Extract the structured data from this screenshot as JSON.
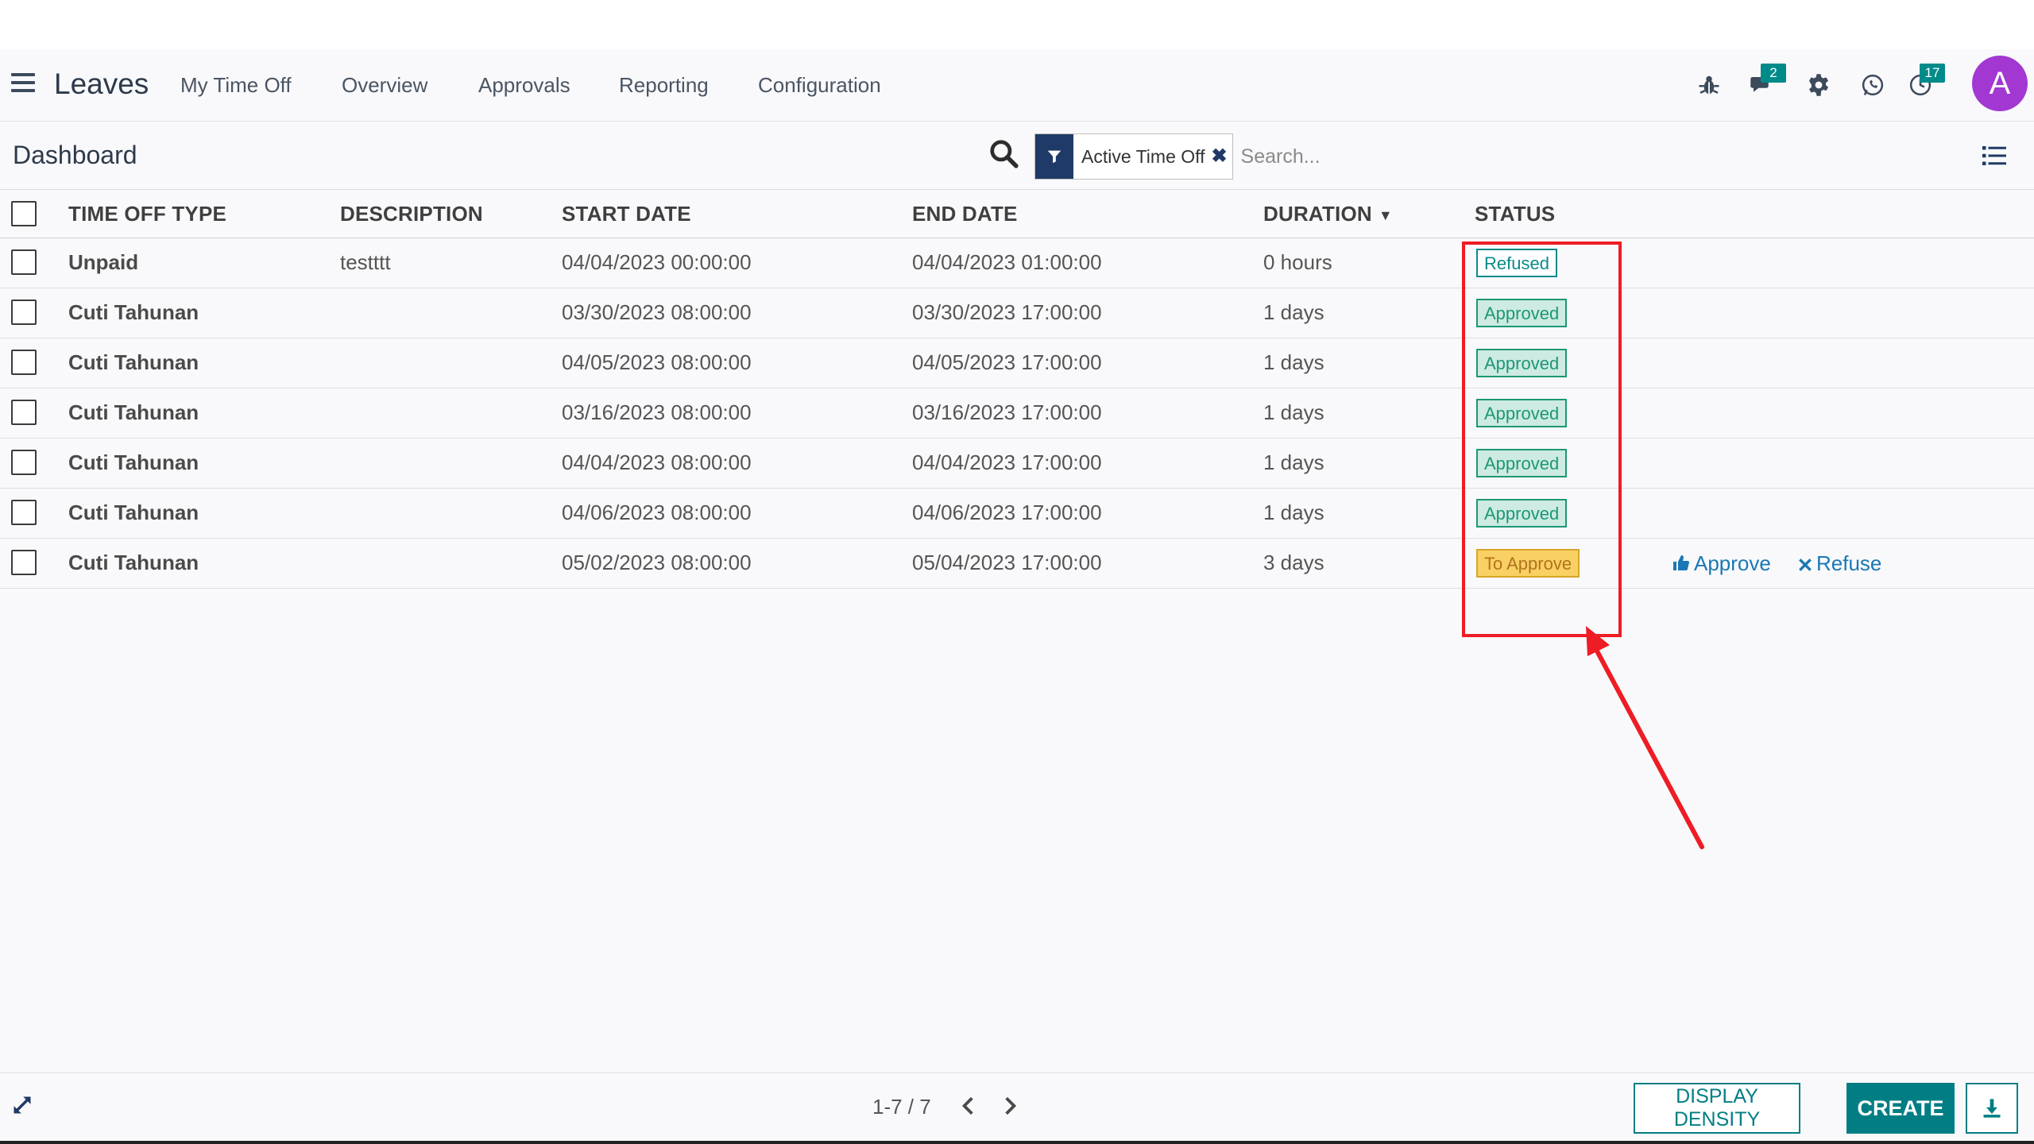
{
  "navbar": {
    "app_name": "Leaves",
    "menu": [
      "My Time Off",
      "Overview",
      "Approvals",
      "Reporting",
      "Configuration"
    ],
    "icons": [
      "bug-icon",
      "chat-icon",
      "gear-icon",
      "whatsapp-icon",
      "activity-icon"
    ],
    "messages_badge": "2",
    "activities_badge": "17",
    "avatar_letter": "A",
    "accent": "#a238d1"
  },
  "control": {
    "breadcrumb": "Dashboard",
    "facet_label": "Active Time Off",
    "search_placeholder": "Search..."
  },
  "table": {
    "columns": [
      "TIME OFF TYPE",
      "DESCRIPTION",
      "START DATE",
      "END DATE",
      "DURATION",
      "STATUS"
    ],
    "rows": [
      {
        "type": "Unpaid",
        "description": "testttt",
        "start": "04/04/2023 00:00:00",
        "end": "04/04/2023 01:00:00",
        "duration": "0 hours",
        "status": "Refused",
        "status_kind": "refused"
      },
      {
        "type": "Cuti Tahunan",
        "description": "",
        "start": "03/30/2023 08:00:00",
        "end": "03/30/2023 17:00:00",
        "duration": "1 days",
        "status": "Approved",
        "status_kind": "approved"
      },
      {
        "type": "Cuti Tahunan",
        "description": "",
        "start": "04/05/2023 08:00:00",
        "end": "04/05/2023 17:00:00",
        "duration": "1 days",
        "status": "Approved",
        "status_kind": "approved"
      },
      {
        "type": "Cuti Tahunan",
        "description": "",
        "start": "03/16/2023 08:00:00",
        "end": "03/16/2023 17:00:00",
        "duration": "1 days",
        "status": "Approved",
        "status_kind": "approved"
      },
      {
        "type": "Cuti Tahunan",
        "description": "",
        "start": "04/04/2023 08:00:00",
        "end": "04/04/2023 17:00:00",
        "duration": "1 days",
        "status": "Approved",
        "status_kind": "approved"
      },
      {
        "type": "Cuti Tahunan",
        "description": "",
        "start": "04/06/2023 08:00:00",
        "end": "04/06/2023 17:00:00",
        "duration": "1 days",
        "status": "Approved",
        "status_kind": "approved"
      },
      {
        "type": "Cuti Tahunan",
        "description": "",
        "start": "05/02/2023 08:00:00",
        "end": "05/04/2023 17:00:00",
        "duration": "3 days",
        "status": "To Approve",
        "status_kind": "toapprove",
        "actions": [
          "Approve",
          "Refuse"
        ]
      }
    ]
  },
  "footer": {
    "pager": "1-7 / 7",
    "display_density_label": "DISPLAY DENSITY",
    "create_label": "CREATE"
  },
  "colors": {
    "primary": "#017e84",
    "approved": "#1d9776",
    "to_approve": "#f8d063",
    "annotation": "#ee1c25"
  }
}
